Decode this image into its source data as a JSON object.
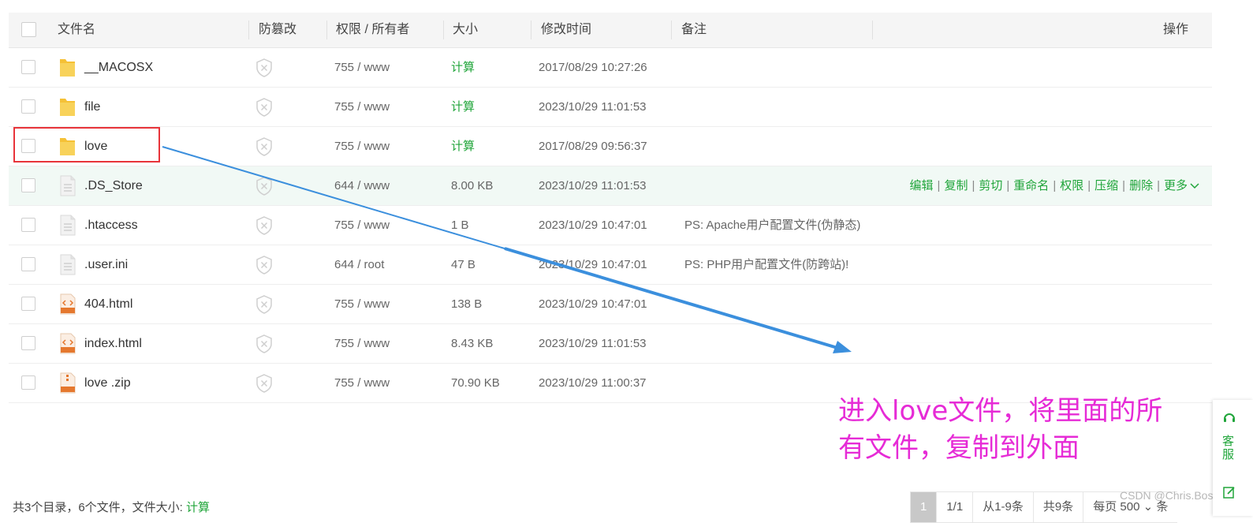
{
  "header": {
    "filename": "文件名",
    "tamper": "防篡改",
    "perm_owner": "权限 / 所有者",
    "size": "大小",
    "mtime": "修改时间",
    "note": "备注",
    "ops": "操作"
  },
  "rows": [
    {
      "name": "__MACOSX",
      "type": "folder",
      "perm": "755 / www",
      "size": "计算",
      "mtime": "2017/08/29 10:27:26",
      "note": ""
    },
    {
      "name": "file",
      "type": "folder",
      "perm": "755 / www",
      "size": "计算",
      "mtime": "2023/10/29 11:01:53",
      "note": ""
    },
    {
      "name": "love",
      "type": "folder",
      "perm": "755 / www",
      "size": "计算",
      "mtime": "2017/08/29 09:56:37",
      "note": ""
    },
    {
      "name": ".DS_Store",
      "type": "file",
      "perm": "644 / www",
      "size": "8.00 KB",
      "mtime": "2023/10/29 11:01:53",
      "note": ""
    },
    {
      "name": ".htaccess",
      "type": "file",
      "perm": "755 / www",
      "size": "1 B",
      "mtime": "2023/10/29 10:47:01",
      "note": "PS: Apache用户配置文件(伪静态)"
    },
    {
      "name": ".user.ini",
      "type": "file",
      "perm": "644 / root",
      "size": "47 B",
      "mtime": "2023/10/29 10:47:01",
      "note": "PS: PHP用户配置文件(防跨站)!"
    },
    {
      "name": "404.html",
      "type": "html",
      "perm": "755 / www",
      "size": "138 B",
      "mtime": "2023/10/29 10:47:01",
      "note": ""
    },
    {
      "name": "index.html",
      "type": "html",
      "perm": "755 / www",
      "size": "8.43 KB",
      "mtime": "2023/10/29 11:01:53",
      "note": ""
    },
    {
      "name": "love .zip",
      "type": "zip",
      "perm": "755 / www",
      "size": "70.90 KB",
      "mtime": "2023/10/29 11:00:37",
      "note": ""
    }
  ],
  "row_ops": [
    "编辑",
    "复制",
    "剪切",
    "重命名",
    "权限",
    "压缩",
    "删除",
    "更多"
  ],
  "annotation": {
    "line1": "进入love文件，将里面的所",
    "line2": "有文件，复制到外面"
  },
  "footer": {
    "summary_prefix": "共3个目录，6个文件，文件大小: ",
    "summary_calc": "计算",
    "page_current": "1",
    "page_of": "1/1",
    "range": "从1-9条",
    "total": "共9条",
    "per_page": "每页 500 ⌄ 条"
  },
  "side_widget": {
    "label": "客服"
  },
  "watermark": "CSDN @Chris.Bosh",
  "icons": {
    "folder": "folder-icon",
    "file": "file-icon",
    "html": "html-file-icon",
    "zip": "zip-file-icon",
    "shield": "shield-icon",
    "chevron": "chevron-down-icon"
  },
  "colors": {
    "accent": "#20a53a",
    "highlight_row": "#f1f9f5",
    "annotation": "#e62bd6",
    "arrow": "#3b8fdd",
    "red_box": "#e8343a"
  }
}
